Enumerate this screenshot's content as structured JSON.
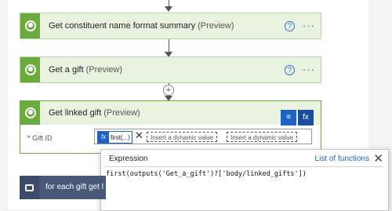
{
  "cards": [
    {
      "title": "Get constituent name format summary",
      "preview": "(Preview)"
    },
    {
      "title": "Get a gift",
      "preview": "(Preview)"
    },
    {
      "title": "Get linked gift",
      "preview": "(Preview)"
    }
  ],
  "help_glyph": "?",
  "more_glyph": "···",
  "plus_glyph": "+",
  "field": {
    "required_mark": "*",
    "label": "Gift ID",
    "token_icon": "fx",
    "token_text": "first(...)",
    "token_close": "✕",
    "dynamic_1": "Insert a dynamic value",
    "dynamic_2": "Insert a dynamic value"
  },
  "dynamic_buttons": {
    "dynamic_content": "≡",
    "expression": "fx"
  },
  "expression_panel": {
    "tab": "Expression",
    "link": "List of functions",
    "close": "✕",
    "value": "first(outputs('Get_a_gift')?['body/linked_gifts'])"
  },
  "foreach": {
    "title": "for each gift get l"
  },
  "colors": {
    "action_green": "#6aab3b",
    "accent_blue": "#1f62c6",
    "loop_slate": "#4a5878"
  }
}
